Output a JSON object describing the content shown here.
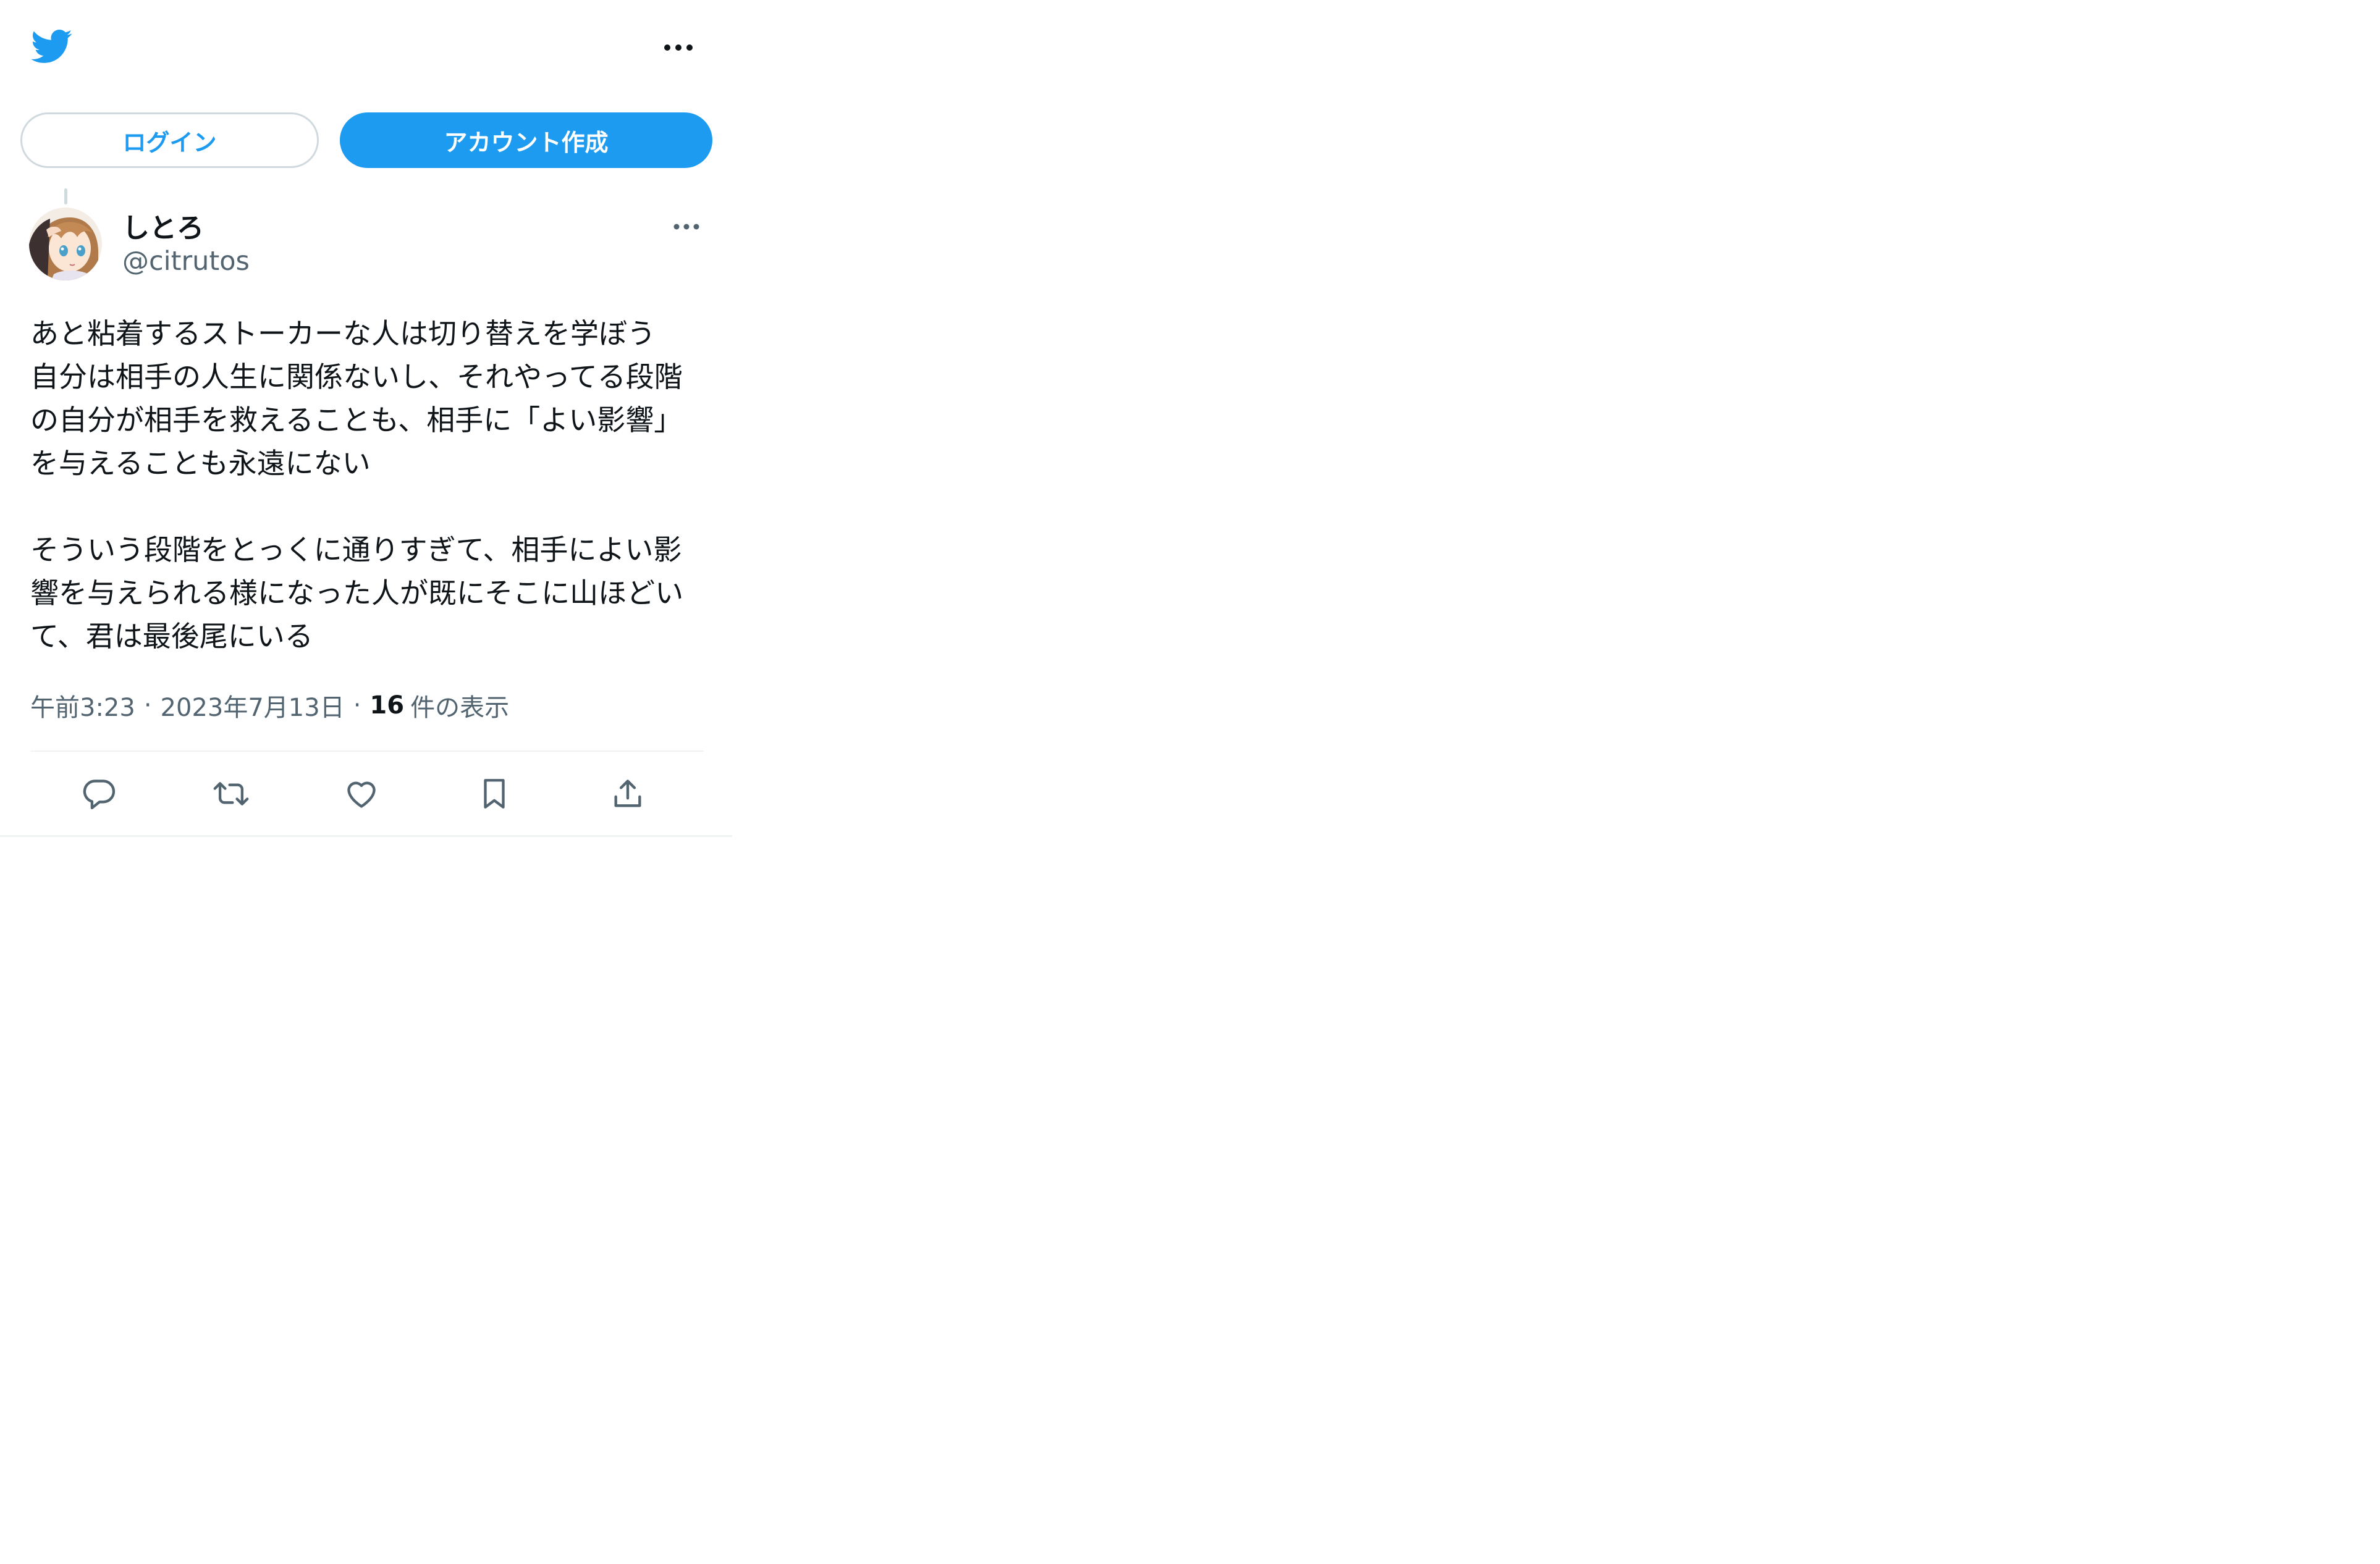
{
  "header": {
    "logo_icon": "twitter-bird-icon",
    "more_icon": "more-horizontal-icon"
  },
  "auth": {
    "login_label": "ログイン",
    "signup_label": "アカウント作成"
  },
  "tweet": {
    "author": {
      "display_name": "しとろ",
      "handle": "@citrutos",
      "avatar_icon": "avatar-anime-girl"
    },
    "text": "あと粘着するストーカーな人は切り替えを学ぼう\n自分は相手の人生に関係ないし、それやってる段階の自分が相手を救えることも、相手に「よい影響」を与えることも永遠にない\n\nそういう段階をとっくに通りすぎて、相手によい影響を与えられる様になった人が既にそこに山ほどいて、君は最後尾にいる",
    "time": "午前3:23",
    "separator": "·",
    "date": "2023年7月13日",
    "views_count": "16",
    "views_label": "件の表示"
  },
  "actions": {
    "reply_icon": "reply-icon",
    "retweet_icon": "retweet-icon",
    "like_icon": "like-heart-icon",
    "bookmark_icon": "bookmark-icon",
    "share_icon": "share-icon"
  },
  "colors": {
    "brand_blue": "#1d9bf0",
    "text_primary": "#0f1419",
    "text_secondary": "#536471",
    "border": "#cfd9de",
    "divider": "#eff3f4"
  }
}
